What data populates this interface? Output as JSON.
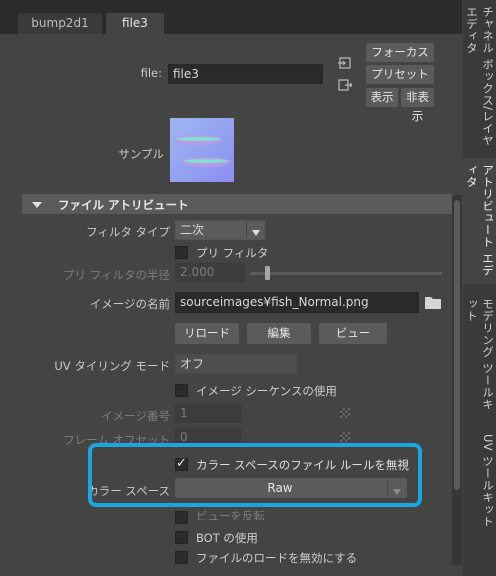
{
  "tabs": [
    {
      "label": "bump2d1"
    },
    {
      "label": "file3"
    }
  ],
  "file_node": {
    "label": "file:",
    "value": "file3",
    "buttons": {
      "focus": "フォーカス",
      "preset": "プリセット",
      "show": "表示",
      "hide": "非表示"
    }
  },
  "sample": {
    "label": "サンプル"
  },
  "section": {
    "title": "ファイル アトリビュート"
  },
  "attributes": {
    "filter_type": {
      "label": "フィルタ タイプ",
      "value": "二次"
    },
    "prefilter": {
      "label": "プリ フィルタ",
      "checked": false
    },
    "prefilter_radius": {
      "label": "プリ フィルタの半径",
      "value": "2.000"
    },
    "image_name": {
      "label": "イメージの名前",
      "value": "sourceimages¥fish_Normal.png"
    },
    "reload_button": "リロード",
    "edit_button": "編集",
    "view_button": "ビュー",
    "uv_tiling": {
      "label": "UV タイリング モード",
      "value": "オフ"
    },
    "image_sequence": {
      "label": "イメージ シーケンスの使用",
      "checked": false
    },
    "image_number": {
      "label": "イメージ番号",
      "value": "1"
    },
    "frame_offset": {
      "label": "フレーム オフセット",
      "value": "0"
    },
    "ignore_color_rules": {
      "label": "カラー スペースのファイル ルールを無視",
      "checked": true
    },
    "color_space": {
      "label": "カラー スペース",
      "value": "Raw"
    },
    "view_transform": {
      "label": "ビューを反転",
      "checked": false
    },
    "use_bot": {
      "label": "BOT の使用",
      "checked": false
    },
    "disable_file_load": {
      "label": "ファイルのロードを無効にする",
      "checked": false
    }
  },
  "side_tabs": [
    {
      "label": "チャネル ボックス/レイヤ エディタ"
    },
    {
      "label": "アトリビュート エディタ"
    },
    {
      "label": "モデリング ツールキット"
    },
    {
      "label": "UV ツールキット"
    }
  ],
  "colors": {
    "highlight": "#1aa7e0",
    "background": "#444444"
  }
}
